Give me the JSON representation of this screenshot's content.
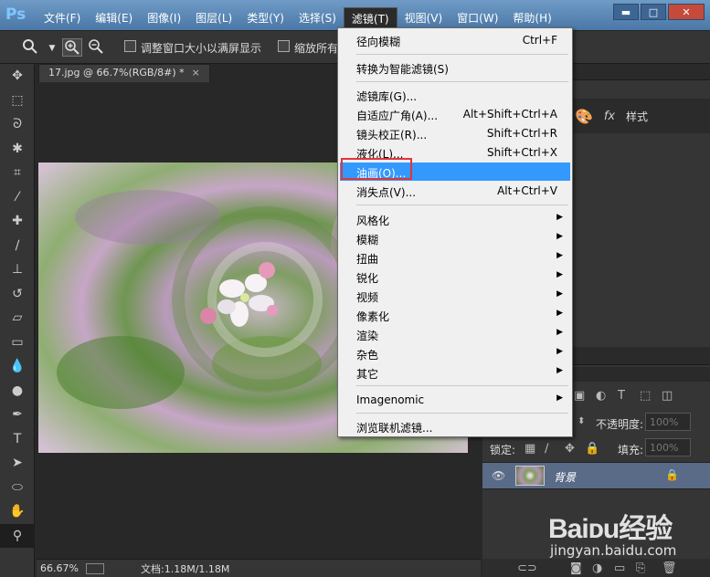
{
  "app": {
    "logo": "Ps"
  },
  "menubar": {
    "items": [
      "文件(F)",
      "编辑(E)",
      "图像(I)",
      "图层(L)",
      "类型(Y)",
      "选择(S)",
      "滤镜(T)",
      "视图(V)",
      "窗口(W)",
      "帮助(H)"
    ],
    "active": "滤镜(T)"
  },
  "window_controls": {
    "min": "▬",
    "max": "□",
    "close": "✕"
  },
  "options": {
    "fit_label": "调整窗口大小以满屏显示",
    "zoom_all_label": "缩放所有"
  },
  "document": {
    "tab_title": "17.jpg @ 66.7%(RGB/8#) *",
    "tab_close": "×",
    "zoom": "66.67%",
    "doc_size": "文档:1.18M/1.18M"
  },
  "filter_menu": {
    "items": [
      {
        "label": "径向模糊",
        "shortcut": "Ctrl+F"
      },
      {
        "label": "转换为智能滤镜(S)",
        "shortcut": ""
      },
      {
        "label": "滤镜库(G)...",
        "shortcut": ""
      },
      {
        "label": "自适应广角(A)...",
        "shortcut": "Alt+Shift+Ctrl+A"
      },
      {
        "label": "镜头校正(R)...",
        "shortcut": "Shift+Ctrl+R"
      },
      {
        "label": "液化(L)...",
        "shortcut": "Shift+Ctrl+X"
      },
      {
        "label": "油画(O)...",
        "shortcut": ""
      },
      {
        "label": "消失点(V)...",
        "shortcut": "Alt+Ctrl+V"
      },
      {
        "label": "风格化",
        "shortcut": ""
      },
      {
        "label": "模糊",
        "shortcut": ""
      },
      {
        "label": "扭曲",
        "shortcut": ""
      },
      {
        "label": "锐化",
        "shortcut": ""
      },
      {
        "label": "视频",
        "shortcut": ""
      },
      {
        "label": "像素化",
        "shortcut": ""
      },
      {
        "label": "渲染",
        "shortcut": ""
      },
      {
        "label": "杂色",
        "shortcut": ""
      },
      {
        "label": "其它",
        "shortcut": ""
      },
      {
        "label": "Imagenomic",
        "shortcut": ""
      },
      {
        "label": "浏览联机滤镜...",
        "shortcut": ""
      }
    ],
    "highlighted": "油画(O)..."
  },
  "panels": {
    "style_label": "样式",
    "opacity_label": "不透明度:",
    "opacity_value": "100%",
    "lock_label": "锁定:",
    "fill_label": "填充:",
    "fill_value": "100%",
    "layer_name": "背景"
  },
  "watermark": {
    "logo": "Baiᴅu经验",
    "url": "jingyan.baidu.com"
  }
}
